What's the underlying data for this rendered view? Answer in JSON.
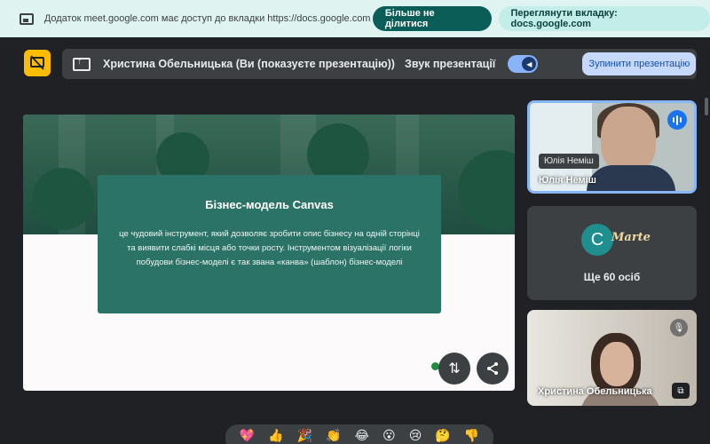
{
  "banner": {
    "message": "Додаток meet.google.com має доступ до вкладки https://docs.google.com",
    "stop_sharing_label": "Більше не ділитися",
    "view_tab_label": "Переглянути вкладку: docs.google.com"
  },
  "presenting": {
    "presenter_text": "Христина Обельницька (Ви (показуєте презентацію))",
    "audio_label": "Звук презентації",
    "stop_button_label": "Зупинити презентацію"
  },
  "slide": {
    "title": "Бізнес-модель Canvas",
    "body": "це чудовий інструмент, який дозволяє зробити опис бізнесу на одній сторінці та виявити слабкі місця або точки росту. Інструментом візуалізації логіки побудови бізнес-моделі є так звана «канва» (шаблон) бізнес-моделі"
  },
  "tiles": {
    "participant_1": {
      "name": "Юлія Неміш",
      "tooltip": "Юлія Неміш"
    },
    "others": {
      "avatar_letter": "C",
      "label": "Marte",
      "count_text": "Ще 60 осіб"
    },
    "participant_2": {
      "name": "Христина Обельницька"
    }
  },
  "reactions": [
    "💖",
    "👍",
    "🎉",
    "👏",
    "😂",
    "😮",
    "😢",
    "🤔",
    "👎"
  ],
  "colors": {
    "banner_bg": "#dff3f1",
    "stop_share_bg": "#0b5d57",
    "card_bg": "#2a7366",
    "accent_blue": "#8ab4f8",
    "logo_yellow": "#fbbc04"
  }
}
